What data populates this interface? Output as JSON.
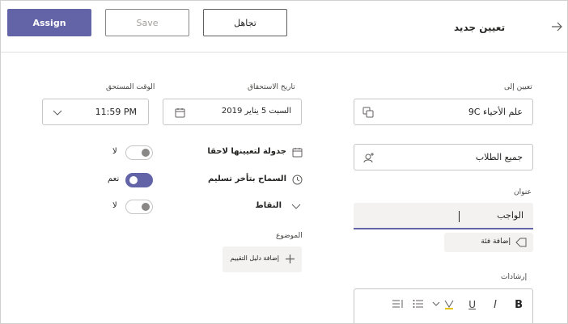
{
  "header": {
    "title": "تعيين جديد",
    "assign_label": "Assign",
    "save_label": "Save",
    "discard_label": "تجاهل"
  },
  "assign_to": {
    "label": "تعيين إلى",
    "class_value": "9C علم الأحياء",
    "students_value": "جميع الطلاب"
  },
  "title_field": {
    "label": "عنوان",
    "value": "الواجب",
    "add_category_label": "إضافة فئة"
  },
  "instructions": {
    "label": "إرشادات"
  },
  "due_date": {
    "label": "تاريخ الاستحقاق",
    "value": "السبت 5 يناير 2019"
  },
  "due_time": {
    "label": "الوقت المستحق",
    "value": "11:59 PM"
  },
  "options": [
    {
      "label": "جدولة لتعيينها لاحقا",
      "state": "لا",
      "on": false
    },
    {
      "label": "السماح بتأخر تسليم",
      "state": "نعم",
      "on": true
    },
    {
      "label": "النقاط",
      "state": "لا",
      "on": false
    }
  ],
  "rubric": {
    "label": "الموضوع",
    "add_label": "إضافة دليل التقييم"
  },
  "colors": {
    "accent": "#6264a7",
    "border": "#c8c6c4",
    "text": "#252423"
  }
}
